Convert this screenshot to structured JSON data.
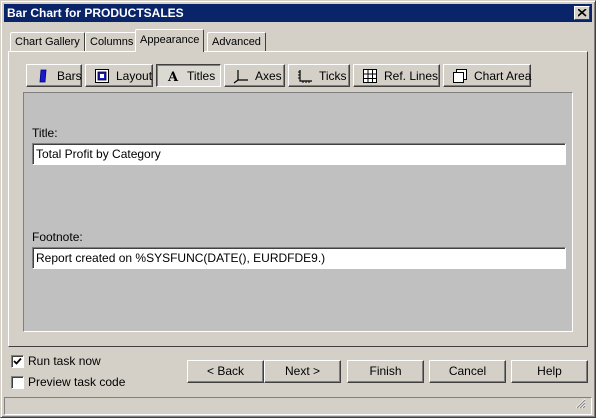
{
  "window": {
    "title": "Bar Chart for PRODUCTSALES"
  },
  "tabs": [
    {
      "label": "Chart Gallery"
    },
    {
      "label": "Columns"
    },
    {
      "label": "Appearance",
      "active": true
    },
    {
      "label": "Advanced"
    }
  ],
  "subtabs": [
    {
      "label": "Bars",
      "icon": "bars-icon"
    },
    {
      "label": "Layout",
      "icon": "layout-icon"
    },
    {
      "label": "Titles",
      "icon": "titles-icon",
      "active": true
    },
    {
      "label": "Axes",
      "icon": "axes-icon"
    },
    {
      "label": "Ticks",
      "icon": "ticks-icon"
    },
    {
      "label": "Ref. Lines",
      "icon": "ref-lines-icon"
    },
    {
      "label": "Chart Area",
      "icon": "chart-area-icon"
    }
  ],
  "titles": {
    "title_label": "Title:",
    "title_value": "Total Profit by Category",
    "footnote_label": "Footnote:",
    "footnote_value": "Report created on %SYSFUNC(DATE(), EURDFDE9.)"
  },
  "options": {
    "run_task_now": {
      "label": "Run task now",
      "checked": true
    },
    "preview_task_code": {
      "label": "Preview task code",
      "checked": false
    }
  },
  "buttons": {
    "back": "< Back",
    "next": "Next >",
    "finish": "Finish",
    "cancel": "Cancel",
    "help": "Help"
  }
}
